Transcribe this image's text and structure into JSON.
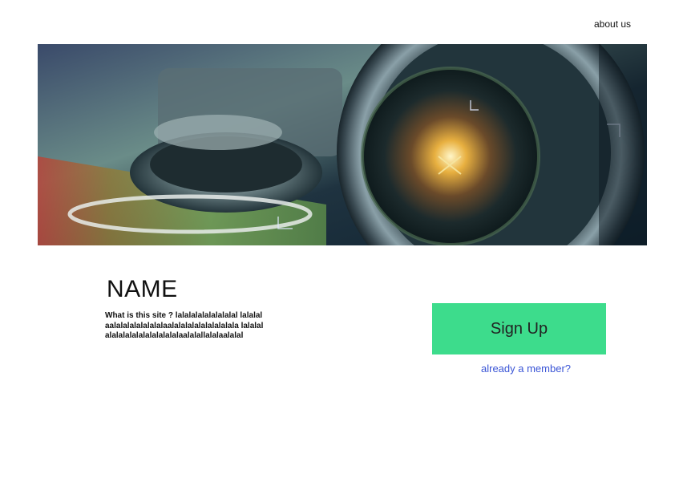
{
  "header": {
    "about_link": "about us"
  },
  "hero": {
    "image_subject": "camera-lens-photo"
  },
  "intro": {
    "name": "NAME",
    "description": "What is this site ? lalalalalalalalalal lalalalaalalalalalalalalaalalalalalalalalalala lalalalalalalalalalalalalalalaalalallalalaalalal"
  },
  "actions": {
    "signup_label": "Sign Up",
    "member_link": "already a member?"
  },
  "colors": {
    "signup_bg": "#3ddc8c",
    "member_link": "#3a55d6"
  }
}
